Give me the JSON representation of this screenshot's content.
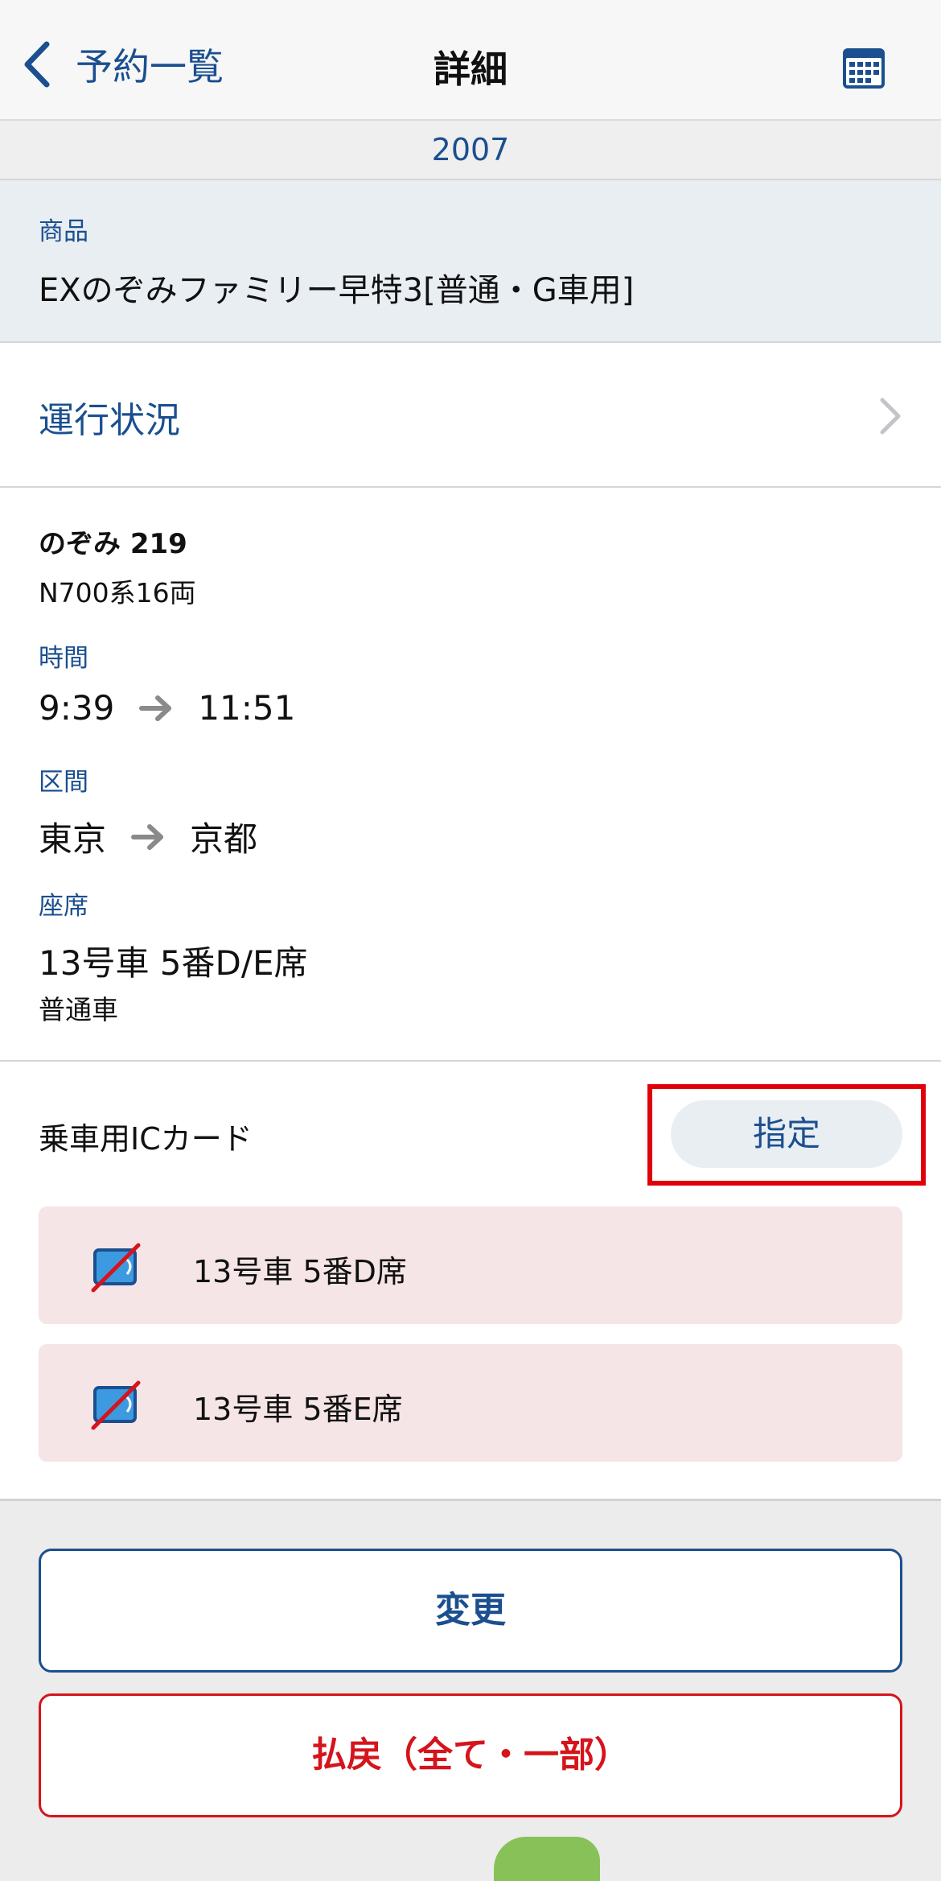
{
  "navbar": {
    "back_label": "予約一覧",
    "title": "詳細",
    "calendar_icon": "calendar-icon"
  },
  "section_header": "2007",
  "product": {
    "label": "商品",
    "value": "EXのぞみファミリー早特3[普通・G車用]"
  },
  "status_row": {
    "label": "運行状況",
    "chevron_icon": "chevron-right-icon"
  },
  "train": {
    "name": "のぞみ 219",
    "type": "N700系16両",
    "time_label": "時間",
    "time_from": "9:39",
    "time_to": "11:51",
    "section_label": "区間",
    "section_from": "東京",
    "section_to": "京都",
    "seat_label": "座席",
    "seat_value": "13号車 5番D/E席",
    "seat_class": "普通車"
  },
  "ic_card": {
    "label": "乗車用ICカード",
    "assign_button": "指定",
    "seats": [
      {
        "label": "13号車 5番D席",
        "icon": "ic-card-unassigned-icon"
      },
      {
        "label": "13号車 5番E席",
        "icon": "ic-card-unassigned-icon"
      }
    ]
  },
  "actions": {
    "change": "変更",
    "refund": "払戻（全て・一部）"
  },
  "colors": {
    "accent": "#1b4f8f",
    "danger": "#d5141b",
    "highlight": "#e0000a",
    "card_bg": "#f6e5e6"
  }
}
